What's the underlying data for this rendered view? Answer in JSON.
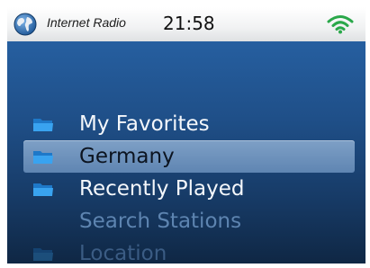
{
  "status_bar": {
    "app_title": "Internet Radio",
    "clock": "21:58",
    "icons": {
      "app": "globe-icon",
      "signal": "wifi-signal-icon"
    }
  },
  "menu": {
    "selected_index": 1,
    "items": [
      {
        "label": "My Favorites",
        "icon": "folder-icon",
        "state": "normal"
      },
      {
        "label": "Germany",
        "icon": "folder-icon",
        "state": "selected"
      },
      {
        "label": "Recently Played",
        "icon": "folder-icon",
        "state": "normal"
      },
      {
        "label": "Search Stations",
        "icon": null,
        "state": "faded"
      },
      {
        "label": "Location",
        "icon": "folder-icon",
        "state": "faded"
      }
    ]
  },
  "colors": {
    "screen_top": "#265fa0",
    "screen_bottom": "#0f2744",
    "selection": "#6f93bd",
    "wifi": "#2aa84a"
  }
}
